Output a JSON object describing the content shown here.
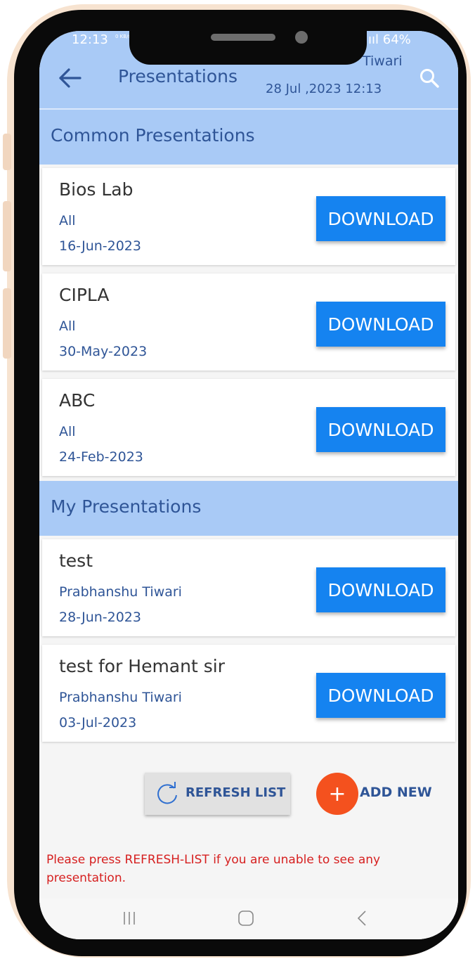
{
  "status_bar": {
    "time": "12:13",
    "network_speed": "0 KB/s",
    "battery": "64%",
    "signal": "ııl"
  },
  "app_bar": {
    "title": "Presentations",
    "user": "Tiwari",
    "datetime": "28 Jul ,2023 12:13",
    "back_icon": "back-arrow-icon",
    "search_icon": "search-icon",
    "background": "#a9caf6",
    "text_color": "#2f5597"
  },
  "sections": {
    "common": {
      "title": "Common Presentations",
      "items": [
        {
          "name": "Bios Lab",
          "owner": "All",
          "date": "16-Jun-2023",
          "action": "DOWNLOAD"
        },
        {
          "name": "CIPLA",
          "owner": "All",
          "date": "30-May-2023",
          "action": "DOWNLOAD"
        },
        {
          "name": "ABC",
          "owner": "All",
          "date": "24-Feb-2023",
          "action": "DOWNLOAD"
        }
      ]
    },
    "mine": {
      "title": "My Presentations",
      "items": [
        {
          "name": "test",
          "owner": "Prabhanshu Tiwari",
          "date": "28-Jun-2023",
          "action": "DOWNLOAD"
        },
        {
          "name": "test for Hemant sir",
          "owner": "Prabhanshu Tiwari",
          "date": "03-Jul-2023",
          "action": "DOWNLOAD"
        }
      ]
    }
  },
  "actions": {
    "refresh_label": "REFRESH LIST",
    "add_label": "ADD NEW",
    "add_symbol": "+",
    "refresh_icon": "refresh-icon",
    "fab_color": "#f4511e",
    "download_color": "#1583f0"
  },
  "note": "Please press REFRESH-LIST if you are unable to see any presentation.",
  "nav_bar": {
    "recent_icon": "recent-apps-icon",
    "home_icon": "home-icon",
    "back_icon": "back-icon"
  }
}
